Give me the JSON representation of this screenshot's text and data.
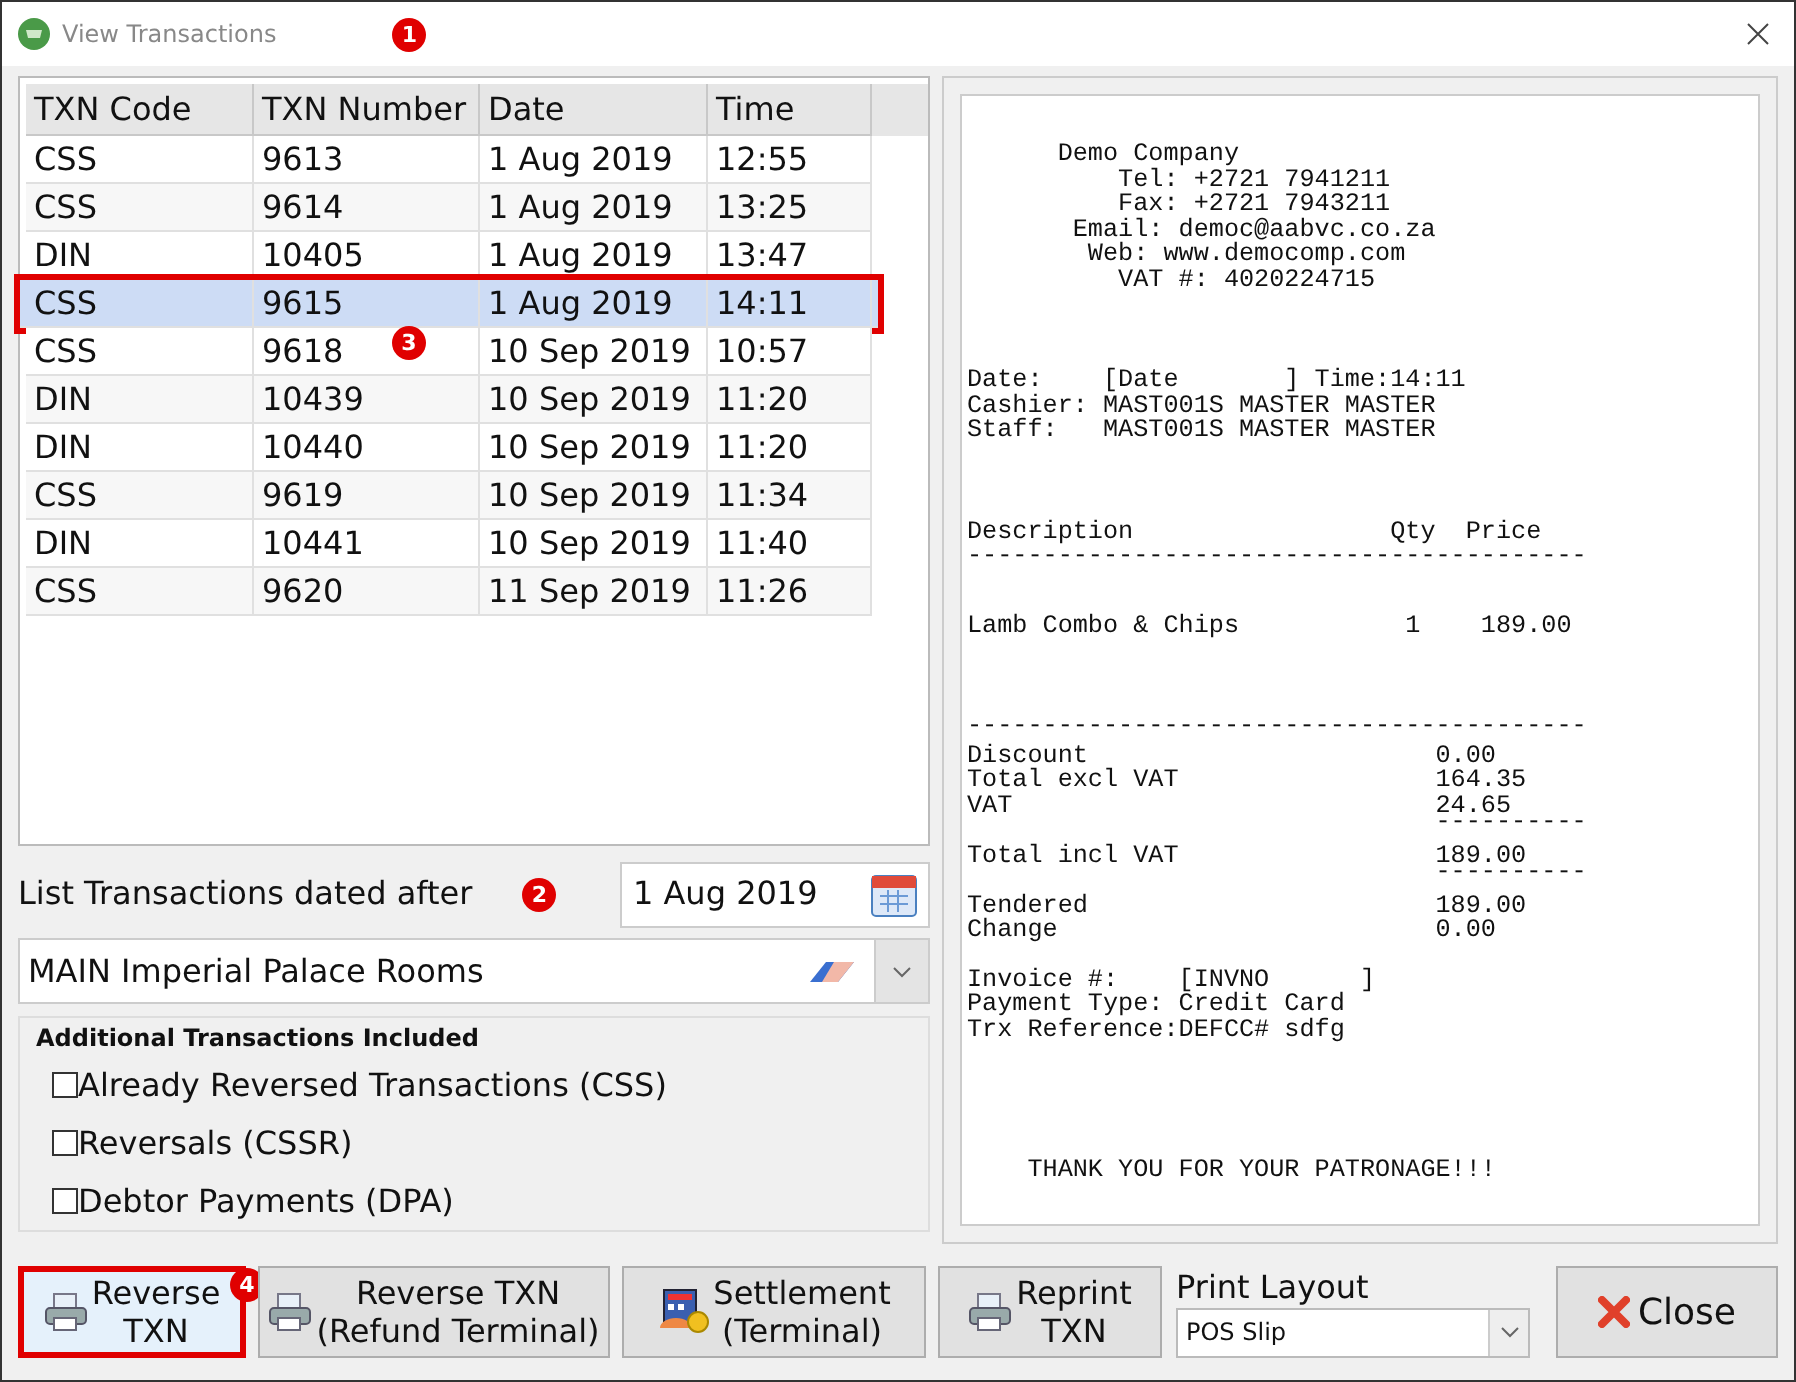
{
  "window": {
    "title": "View Transactions",
    "callout": "1"
  },
  "table": {
    "columns": [
      "TXN Code",
      "TXN Number",
      "Date",
      "Time"
    ],
    "callout": "3",
    "rows": [
      {
        "cells": [
          "CSS",
          "9613",
          "1 Aug 2019",
          "12:55"
        ],
        "selected": false,
        "highlighted": false
      },
      {
        "cells": [
          "CSS",
          "9614",
          "1 Aug 2019",
          "13:25"
        ],
        "selected": false,
        "highlighted": false
      },
      {
        "cells": [
          "DIN",
          "10405",
          "1 Aug 2019",
          "13:47"
        ],
        "selected": false,
        "highlighted": false
      },
      {
        "cells": [
          "CSS",
          "9615",
          "1 Aug 2019",
          "14:11"
        ],
        "selected": true,
        "highlighted": true
      },
      {
        "cells": [
          "CSS",
          "9618",
          "10 Sep 2019",
          "10:57"
        ],
        "selected": false,
        "highlighted": false
      },
      {
        "cells": [
          "DIN",
          "10439",
          "10 Sep 2019",
          "11:20"
        ],
        "selected": false,
        "highlighted": false
      },
      {
        "cells": [
          "DIN",
          "10440",
          "10 Sep 2019",
          "11:20"
        ],
        "selected": false,
        "highlighted": false
      },
      {
        "cells": [
          "CSS",
          "9619",
          "10 Sep 2019",
          "11:34"
        ],
        "selected": false,
        "highlighted": false
      },
      {
        "cells": [
          "DIN",
          "10441",
          "10 Sep 2019",
          "11:40"
        ],
        "selected": false,
        "highlighted": false
      },
      {
        "cells": [
          "CSS",
          "9620",
          "11 Sep 2019",
          "11:26"
        ],
        "selected": false,
        "highlighted": false
      }
    ]
  },
  "date_filter": {
    "label": "List Transactions dated after",
    "callout": "2",
    "value": "1 Aug 2019"
  },
  "location": {
    "value": "MAIN Imperial Palace Rooms"
  },
  "additional": {
    "title": "Additional Transactions Included",
    "options": [
      {
        "label": "Already Reversed Transactions (CSS)",
        "checked": false
      },
      {
        "label": "Reversals (CSSR)",
        "checked": false
      },
      {
        "label": "Debtor Payments (DPA)",
        "checked": false
      }
    ]
  },
  "receipt": {
    "blocks": [
      {
        "lines": [
          "      Demo Company",
          "          Tel: +2721 7941211",
          "          Fax: +2721 7943211",
          "       Email: democ@aabvc.co.za",
          "        Web: www.democomp.com",
          "          VAT #: 4020224715"
        ]
      },
      {
        "lines": [
          "Date:    [Date       ] Time:14:11",
          "Cashier: MAST001S MASTER MASTER",
          "Staff:   MAST001S MASTER MASTER"
        ]
      },
      {
        "lines": [
          "Description                 Qty  Price",
          "-----------------------------------------"
        ]
      },
      {
        "lines": [
          "Lamb Combo & Chips           1    189.00"
        ]
      },
      {
        "lines": [
          "-----------------------------------------"
        ]
      },
      {
        "kind": "totals",
        "rows": [
          {
            "label": "Discount",
            "value": "0.00"
          },
          {
            "label": "Total excl VAT",
            "value": "164.35"
          },
          {
            "label": "VAT",
            "value": "24.65"
          },
          {
            "value": "----------"
          },
          {
            "label": "Total incl VAT",
            "value": "189.00"
          },
          {
            "value": "----------"
          },
          {
            "label": "Tendered",
            "value": "189.00"
          },
          {
            "label": "Change",
            "value": "0.00"
          }
        ]
      },
      {
        "lines": [
          "Invoice #:    [INVNO      ]",
          "Payment Type: Credit Card",
          "Trx Reference:DEFCC# sdfg"
        ]
      },
      {
        "lines": [
          "    THANK YOU FOR YOUR PATRONAGE!!!"
        ]
      }
    ]
  },
  "buttons": [
    {
      "kind": "print",
      "lines": [
        "Reverse",
        "TXN"
      ],
      "highlighted": true,
      "callout": "4"
    },
    {
      "kind": "print",
      "lines": [
        "Reverse TXN",
        "(Refund Terminal)"
      ],
      "highlighted": false
    },
    {
      "kind": "settlement",
      "lines": [
        "Settlement",
        "(Terminal)"
      ],
      "highlighted": false
    },
    {
      "kind": "print",
      "lines": [
        "Reprint",
        "TXN"
      ],
      "highlighted": false
    }
  ],
  "print_layout": {
    "label": "Print Layout",
    "value": "POS Slip"
  },
  "close_button": {
    "label": "Close"
  }
}
